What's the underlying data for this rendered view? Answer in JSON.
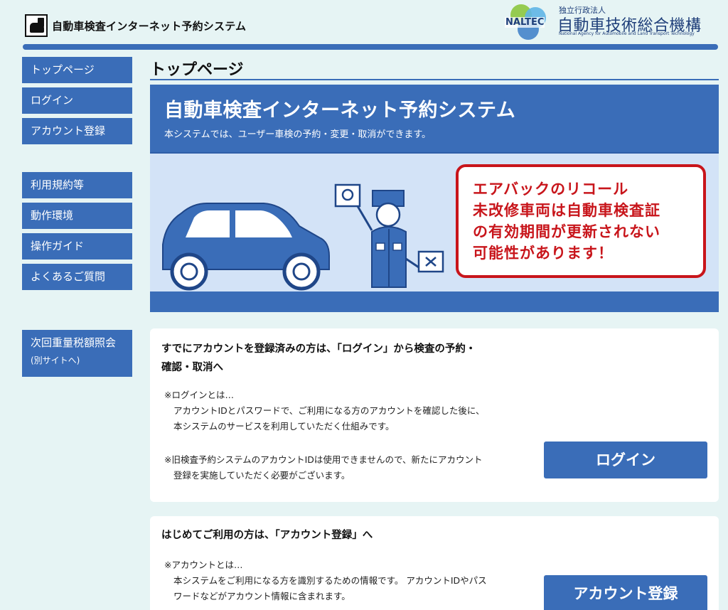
{
  "header": {
    "app_title": "自動車検査インターネット予約システム",
    "org_small": "独立行政法人",
    "org_name": "自動車技術総合機構",
    "org_abbr": "NALTEC",
    "org_english": "National Agency for Automobile and Land Transport Technology"
  },
  "sidebar": {
    "top_page": "トップページ",
    "login": "ログイン",
    "account_register": "アカウント登録",
    "terms": "利用規約等",
    "environment": "動作環境",
    "guide": "操作ガイド",
    "faq": "よくあるご質問",
    "tax_inquiry": "次回重量税額照会",
    "tax_inquiry_sub": "(別サイトへ)"
  },
  "main": {
    "page_title": "トップページ",
    "hero_title": "自動車検査インターネット予約システム",
    "hero_subtitle": "本システムでは、ユーザー車検の予約・変更・取消ができます。",
    "recall_lines": [
      "エアバックのリコール",
      "未改修車両は自動車検査証",
      "の有効期間が更新されない",
      "可能性があります！"
    ],
    "login_card": {
      "heading_line1": "すでにアカウントを登録済みの方は、「ログイン」から検査の予約・",
      "heading_line2": "確認・取消へ",
      "note1_title": "※ログインとは…",
      "note1_line1": "アカウントIDとパスワードで、ご利用になる方のアカウントを確認した後に、",
      "note1_line2": "本システムのサービスを利用していただく仕組みです。",
      "note2_line1": "※旧検査予約システムのアカウントIDは使用できませんので、新たにアカウント",
      "note2_line2": "登録を実施していただく必要がございます。",
      "button": "ログイン"
    },
    "register_card": {
      "heading": "はじめてご利用の方は、「アカウント登録」へ",
      "note_title": "※アカウントとは…",
      "note_line1": "本システムをご利用になる方を識別するための情報です。 アカウントIDやパス",
      "note_line2": "ワードなどがアカウント情報に含まれます。",
      "button": "アカウント登録"
    }
  }
}
